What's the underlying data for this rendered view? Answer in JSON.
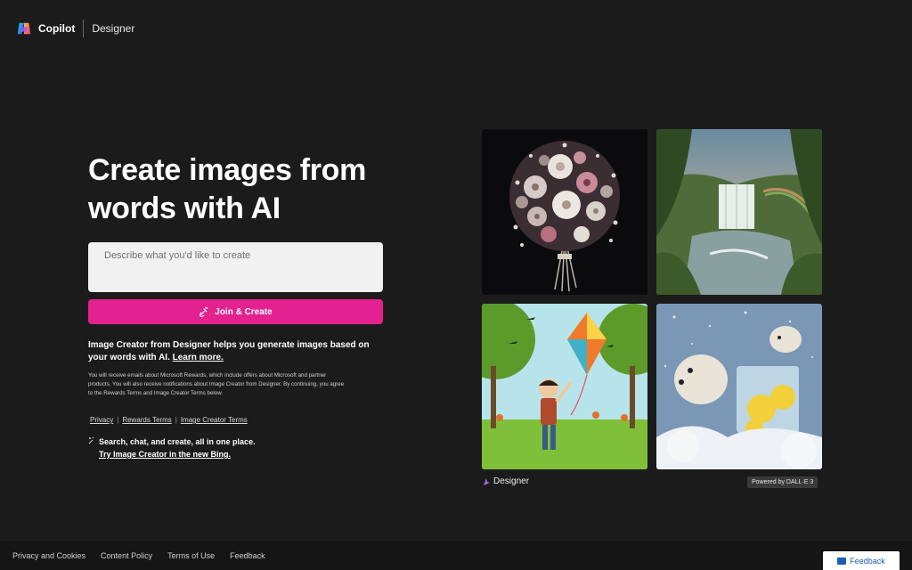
{
  "header": {
    "brand": "Copilot",
    "product": "Designer"
  },
  "hero": {
    "title": "Create images from words with AI"
  },
  "prompt": {
    "placeholder": "Describe what you'd like to create",
    "value": ""
  },
  "create_button": {
    "label": "Join & Create"
  },
  "description": {
    "text": "Image Creator from Designer helps you generate images based on your words with AI.",
    "learn_more": "Learn more."
  },
  "fine_print": "You will receive emails about Microsoft Rewards, which include offers about Microsoft and partner products. You will also receive notifications about Image Creator from Designer. By continuing, you agree to the Rewards Terms and Image Creator Terms below.",
  "legal_links": {
    "privacy": "Privacy",
    "rewards_terms": "Rewards Terms",
    "image_creator_terms": "Image Creator Terms",
    "separator": "|"
  },
  "promo": {
    "text": "Search, chat, and create, all in one place.",
    "link": "Try Image Creator in the new Bing."
  },
  "gallery": {
    "images": [
      {
        "icon": "flower-bouquet-image"
      },
      {
        "icon": "waterfall-rainforest-image"
      },
      {
        "icon": "boy-flying-kite-image"
      },
      {
        "icon": "polar-bears-lemonade-image"
      }
    ],
    "designer_label": "Designer",
    "powered_by": "Powered by DALL·E 3"
  },
  "footer": {
    "links": [
      "Privacy and Cookies",
      "Content Policy",
      "Terms of Use",
      "Feedback"
    ],
    "feedback_button": "Feedback"
  },
  "colors": {
    "background": "#1b1b1b",
    "accent": "#e3228f",
    "input_bg": "#f1f1f1"
  }
}
